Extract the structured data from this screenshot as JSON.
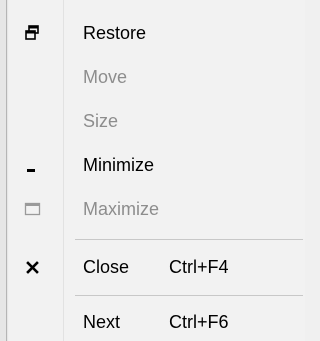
{
  "menu": {
    "items": [
      {
        "label": "Restore",
        "icon": "restore-icon",
        "enabled": true
      },
      {
        "label": "Move",
        "icon": "",
        "enabled": false
      },
      {
        "label": "Size",
        "icon": "",
        "enabled": false
      },
      {
        "label": "Minimize",
        "icon": "minimize-icon",
        "enabled": true
      },
      {
        "label": "Maximize",
        "icon": "maximize-icon",
        "enabled": false
      },
      {
        "label": "Close",
        "shortcut": "Ctrl+F4",
        "icon": "close-icon",
        "enabled": true
      },
      {
        "label": "Next",
        "shortcut": "Ctrl+F6",
        "icon": "",
        "enabled": true
      }
    ]
  },
  "colors": {
    "enabled_text": "#000000",
    "disabled_text": "#8d8d8d",
    "background": "#f2f2f2"
  }
}
